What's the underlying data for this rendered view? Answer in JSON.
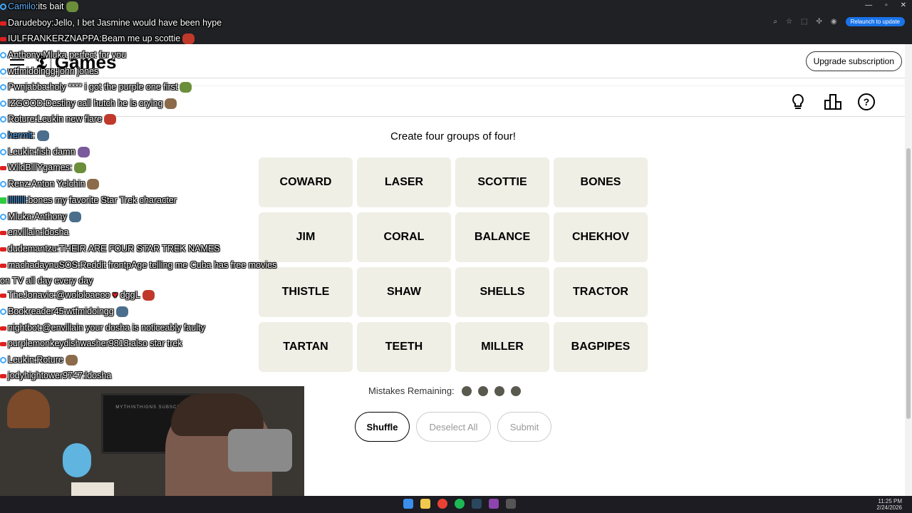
{
  "browser": {
    "relaunch_label": "Relaunch to update"
  },
  "header": {
    "logo_mark": "𝕿",
    "logo_sep": "|",
    "logo_text": "Games",
    "upgrade_label": "Upgrade subscription"
  },
  "game": {
    "prompt": "Create four groups of four!",
    "tiles": [
      "COWARD",
      "LASER",
      "SCOTTIE",
      "BONES",
      "JIM",
      "CORAL",
      "BALANCE",
      "CHEKHOV",
      "THISTLE",
      "SHAW",
      "SHELLS",
      "TRACTOR",
      "TARTAN",
      "TEETH",
      "MILLER",
      "BAGPIPES"
    ],
    "mistakes_label": "Mistakes Remaining:",
    "mistakes_remaining": 4,
    "shuffle_label": "Shuffle",
    "deselect_label": "Deselect All",
    "submit_label": "Submit"
  },
  "chat": [
    {
      "user": "Camilo",
      "msg": "its bait",
      "badge": "blue",
      "color": "#5fb3ff"
    },
    {
      "user": "Darudeboy",
      "msg": "Jello, I bet Jasmine would have been hype",
      "badge": "red",
      "color": "#ffffff"
    },
    {
      "user": "IULFRANKERZNAPPA",
      "msg": "Beam me up scottie",
      "badge": "red",
      "color": "#ffffff"
    },
    {
      "user": "Anthony",
      "msg": "Mluka perfect for you",
      "badge": "blue",
      "color": "#ffffff"
    },
    {
      "user": "wtfmidoingg",
      "msg": "john jones",
      "badge": "blue",
      "color": "#ffffff"
    },
    {
      "user": "Pwnjabba",
      "msg": "holy **** i got the purple one first",
      "badge": "blue",
      "color": "#ffffff"
    },
    {
      "user": "IZGOOD",
      "msg": "Destiny call hutch he is crying",
      "badge": "blue",
      "color": "#ffffff"
    },
    {
      "user": "Roture",
      "msg": "Leukin new flare",
      "badge": "blue",
      "color": "#ffffff"
    },
    {
      "user": "hermit",
      "msg": "",
      "badge": "blue",
      "color": "#5fb3ff"
    },
    {
      "user": "Leukin",
      "msg": "fish damn",
      "badge": "blue",
      "color": "#ffffff"
    },
    {
      "user": "WildBillYgames",
      "msg": "",
      "badge": "red",
      "color": "#ffffff"
    },
    {
      "user": "Renz",
      "msg": "Anton Yelchin",
      "badge": "blue",
      "color": "#ffffff"
    },
    {
      "user": "lllllllll",
      "msg": "bones my favorite Star Trek character",
      "badge": "green",
      "color": "#5fb3ff"
    },
    {
      "user": "Mluka",
      "msg": "Anthony",
      "badge": "blue",
      "color": "#ffffff"
    },
    {
      "user": "envillain",
      "msg": "ldosha",
      "badge": "red",
      "color": "#ffffff"
    },
    {
      "user": "dudemantzu",
      "msg": "THEIR ARE FOUR STAR TREK NAMES",
      "badge": "red",
      "color": "#ffffff"
    },
    {
      "user": "machadaynuSOS",
      "msg": "Reddit frontpAge telling me Cuba has free movies on TV all day every day",
      "badge": "red",
      "color": "#ffffff"
    },
    {
      "user": "TheJonavic",
      "msg": "@wololoaeoo",
      "suffix": "dggL",
      "badge": "red",
      "color": "#ffffff"
    },
    {
      "user": "Bookreader45",
      "msg": "wtfmidoingg",
      "badge": "blue",
      "color": "#ffffff"
    },
    {
      "user": "nightbot",
      "msg": "@envillain your dosha is noticeably faulty",
      "badge": "red",
      "color": "#ffffff"
    },
    {
      "user": "purplemonkeydishwasher9818",
      "msg": "also star trek",
      "badge": "red",
      "color": "#ffffff"
    },
    {
      "user": "Leukin",
      "msg": "Roture",
      "badge": "blue",
      "color": "#ffffff"
    },
    {
      "user": "jodyhightower9747",
      "msg": "ldosha",
      "badge": "red",
      "color": "#ffffff"
    }
  ],
  "webcam": {
    "monitor_text": "MYTHINTHIGNS SUBSCRIBED"
  },
  "taskbar": {
    "time": "11:25 PM",
    "date": "2/24/2026"
  },
  "icons": [
    "hint-bulb-icon",
    "stats-icon",
    "help-icon"
  ],
  "colors": {
    "tile_bg": "#efefe6",
    "dot": "#5a594e",
    "accent_blue": "#1a73e8"
  }
}
